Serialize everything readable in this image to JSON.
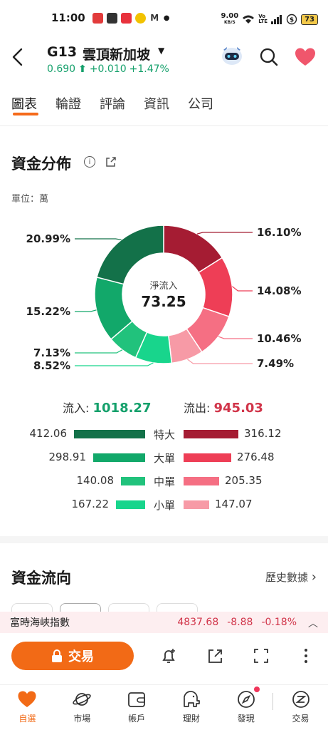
{
  "status_bar": {
    "time": "11:00",
    "speed": "9.00",
    "speed_unit": "KB/S",
    "battery": "73",
    "apps": [
      "news",
      "shopping",
      "hkm",
      "coin",
      "gmail"
    ]
  },
  "header": {
    "code": "G13",
    "name": "雲頂新加坡",
    "price": "0.690",
    "change": "+0.010",
    "change_pct": "+1.47%"
  },
  "tabs": [
    {
      "label": "圖表",
      "active": true
    },
    {
      "label": "輪證",
      "active": false
    },
    {
      "label": "評論",
      "active": false
    },
    {
      "label": "資訊",
      "active": false
    },
    {
      "label": "公司",
      "active": false
    }
  ],
  "fund_distribution": {
    "title": "資金分佈",
    "unit": "單位：萬",
    "center_label": "淨流入",
    "center_value": "73.25",
    "inflow_label": "流入:",
    "inflow_value": "1018.27",
    "outflow_label": "流出:",
    "outflow_value": "945.03"
  },
  "chart_data": {
    "type": "pie",
    "center_text": "淨流入 73.25",
    "series": [
      {
        "name": "特大",
        "side": "out",
        "pct": "16.10%",
        "value": 16.1,
        "color": "#a51c33"
      },
      {
        "name": "大單",
        "side": "out",
        "pct": "14.08%",
        "value": 14.08,
        "color": "#ee3e56"
      },
      {
        "name": "中單",
        "side": "out",
        "pct": "10.46%",
        "value": 10.46,
        "color": "#f56f83"
      },
      {
        "name": "小單",
        "side": "out",
        "pct": "7.49%",
        "value": 7.49,
        "color": "#f79aa6"
      },
      {
        "name": "小單",
        "side": "in",
        "pct": "8.52%",
        "value": 8.52,
        "color": "#18d58c"
      },
      {
        "name": "中單",
        "side": "in",
        "pct": "7.13%",
        "value": 7.13,
        "color": "#21c27c"
      },
      {
        "name": "大單",
        "side": "in",
        "pct": "15.22%",
        "value": 15.22,
        "color": "#12a86a"
      },
      {
        "name": "特大",
        "side": "in",
        "pct": "20.99%",
        "value": 20.99,
        "color": "#137149"
      }
    ]
  },
  "flow_rows": [
    {
      "label": "特大",
      "in": "412.06",
      "in_val": 412.06,
      "out": "316.12",
      "out_val": 316.12,
      "in_color": "#137149",
      "out_color": "#a51c33"
    },
    {
      "label": "大單",
      "in": "298.91",
      "in_val": 298.91,
      "out": "276.48",
      "out_val": 276.48,
      "in_color": "#12a86a",
      "out_color": "#ee3e56"
    },
    {
      "label": "中單",
      "in": "140.08",
      "in_val": 140.08,
      "out": "205.35",
      "out_val": 205.35,
      "in_color": "#21c27c",
      "out_color": "#f56f83"
    },
    {
      "label": "小單",
      "in": "167.22",
      "in_val": 167.22,
      "out": "147.07",
      "out_val": 147.07,
      "in_color": "#18d58c",
      "out_color": "#f79aa6"
    }
  ],
  "fund_flow": {
    "title": "資金流向",
    "history_link": "歷史數據",
    "history_caret": "›"
  },
  "ticker": {
    "name": "富時海峽指數",
    "value": "4837.68",
    "change": "-8.88",
    "change_pct": "-0.18%"
  },
  "action_bar": {
    "trade_label": "交易",
    "icons": [
      "bell-plus-icon",
      "share-icon",
      "fullscreen-icon",
      "more-icon"
    ]
  },
  "bottom_nav": [
    {
      "label": "自選",
      "icon": "heart-icon",
      "active": true
    },
    {
      "label": "市場",
      "icon": "planet-icon",
      "active": false
    },
    {
      "label": "帳戶",
      "icon": "wallet-icon",
      "active": false
    },
    {
      "label": "理財",
      "icon": "elephant-icon",
      "active": false
    },
    {
      "label": "發現",
      "icon": "compass-icon",
      "active": false,
      "badge": true
    },
    {
      "label": "交易",
      "icon": "trade-icon",
      "active": false
    }
  ],
  "colors": {
    "accent": "#f26a16",
    "up": "#14a06b",
    "down": "#d1354a"
  }
}
